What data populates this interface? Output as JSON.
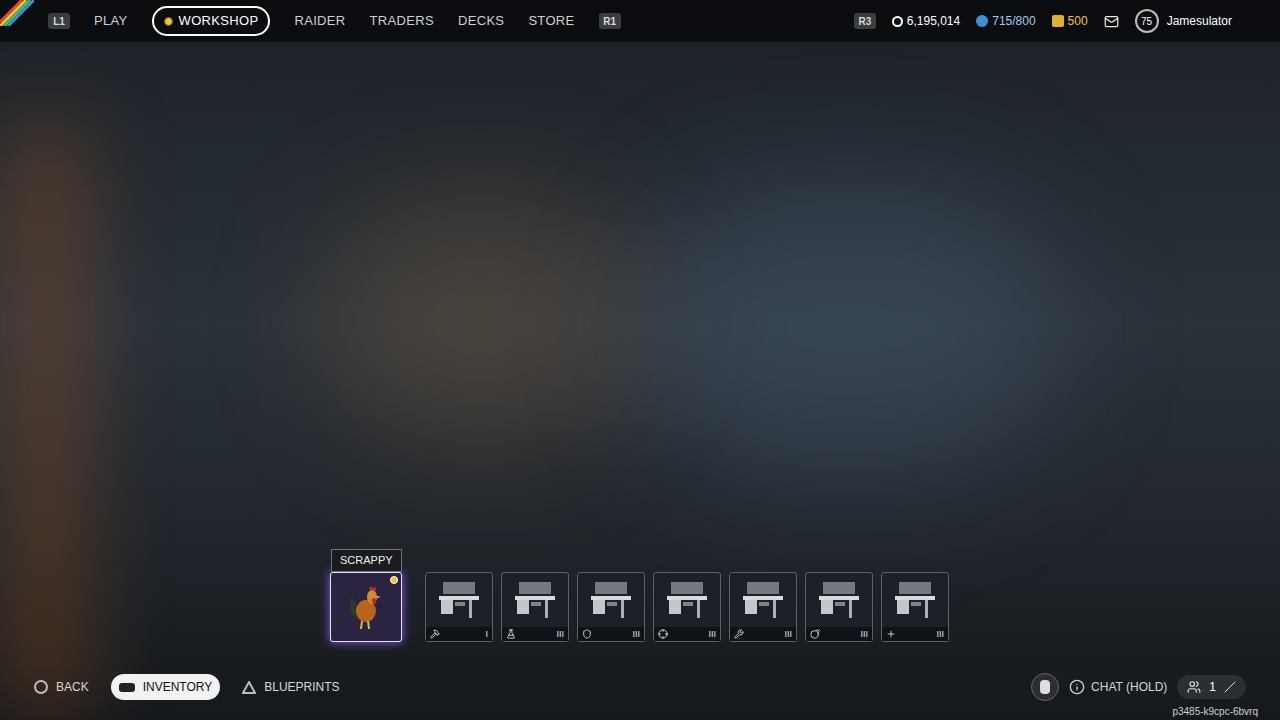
{
  "nav": {
    "left_button": "L1",
    "right_button": "R1",
    "tabs": [
      {
        "label": "PLAY",
        "selected": false
      },
      {
        "label": "WORKSHOP",
        "selected": true
      },
      {
        "label": "RAIDER",
        "selected": false
      },
      {
        "label": "TRADERS",
        "selected": false
      },
      {
        "label": "DECKS",
        "selected": false
      },
      {
        "label": "STORE",
        "selected": false
      }
    ]
  },
  "currency": {
    "button": "R3",
    "coins": "6,195,014",
    "capacity": "715/800",
    "credits": "500"
  },
  "player": {
    "level": "75",
    "name": "Jamesulator"
  },
  "workstations": [
    {
      "kind": "pet",
      "name": "SCRAPPY",
      "selected": true,
      "tier": ""
    },
    {
      "kind": "bench",
      "selected": false,
      "tier": "I"
    },
    {
      "kind": "bench",
      "selected": false,
      "tier": "III"
    },
    {
      "kind": "bench",
      "selected": false,
      "tier": "III"
    },
    {
      "kind": "bench",
      "selected": false,
      "tier": "III"
    },
    {
      "kind": "bench",
      "selected": false,
      "tier": "III"
    },
    {
      "kind": "bench",
      "selected": false,
      "tier": "III"
    },
    {
      "kind": "bench",
      "selected": false,
      "tier": "III"
    }
  ],
  "bottom_bar": {
    "actions": [
      {
        "label": "BACK",
        "selected": false
      },
      {
        "label": "INVENTORY",
        "selected": true
      },
      {
        "label": "BLUEPRINTS",
        "selected": false
      }
    ],
    "chat": "CHAT (HOLD)",
    "party_count": "1"
  },
  "session_code": "p3485-k9cpc-6bvrq"
}
